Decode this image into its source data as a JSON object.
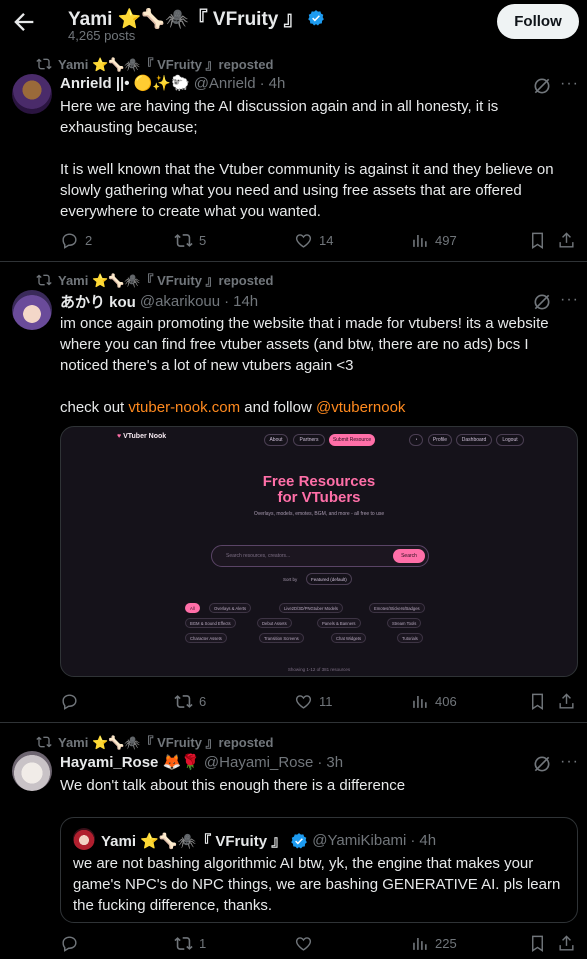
{
  "header": {
    "back_icon": "arrow-left-icon",
    "title": "Yami ⭐🦴🕷️『 VFruity 』",
    "posts_count": "4,265 posts",
    "follow_label": "Follow"
  },
  "colors": {
    "accent_link": "#ff8a1f",
    "verified": "#1d9bf0",
    "muted": "#71767b",
    "text": "#e7e9ea",
    "border": "#2f3336"
  },
  "posts": [
    {
      "repost_label": "Yami ⭐🦴🕷️『 VFruity 』reposted",
      "author": "Anrield ||• 🟡✨🐑",
      "handle": "@Anrield",
      "time": "4h",
      "text_p1": "Here we are having the AI discussion again and in all honesty, it is exhausting because;",
      "text_p2": "It is well known that the Vtuber community is against it and they believe on slowly gathering what you need and using free assets that are offered everywhere to create what you wanted.",
      "replies": "2",
      "reposts": "5",
      "likes": "14",
      "views": "497"
    },
    {
      "repost_label": "Yami ⭐🦴🕷️『 VFruity 』reposted",
      "author": "あかり kou",
      "handle": "@akarikouu",
      "time": "14h",
      "text_p1": "im once again promoting the website that i made for vtubers! its a website where you can find free vtuber assets (and btw, there are no ads) bcs I noticed there's a lot of new vtubers again <3",
      "text_p2_prefix": "check out ",
      "link1": "vtuber-nook.com",
      "text_p2_mid": " and follow ",
      "link2": "@vtubernook",
      "replies": "",
      "reposts": "6",
      "likes": "11",
      "views": "406",
      "media": {
        "brand": "VTuber Nook",
        "nav": [
          "About",
          "Partners",
          "Submit Resource",
          "Profile",
          "Dashboard",
          "Logout"
        ],
        "heading1": "Free Resources",
        "heading2": "for VTubers",
        "tagline": "Overlays, models, emotes, BGM, and more - all free to use",
        "search_placeholder": "Search resources, creators...",
        "search_button": "Search",
        "sort_label": "Sort by",
        "sort_value": "Featured (default)",
        "chips": [
          "All",
          "Overlays & Alerts",
          "Live2D/3D/PNGtuber Models",
          "Emotes/Stickers/Badges",
          "BGM & Sound Effects",
          "Debut Assets",
          "Panels & Banners",
          "Stream Tools",
          "Character Assets",
          "Transition Screens",
          "Chat Widgets",
          "Tutorials"
        ],
        "footer": "Showing 1-12 of 381 resources"
      }
    },
    {
      "repost_label": "Yami ⭐🦴🕷️『 VFruity 』reposted",
      "author": "Hayami_Rose 🦊🌹",
      "handle": "@Hayami_Rose",
      "time": "3h",
      "text_p1": "We don't talk about this enough there is a difference",
      "quote": {
        "author": "Yami ⭐🦴🕷️『 VFruity 』",
        "handle": "@YamiKibami",
        "time": "4h",
        "text": "we are not bashing algorithmic AI btw, yk, the engine that makes your game's NPC's do NPC things, we are bashing GENERATIVE AI. pls learn the fucking difference, thanks."
      },
      "replies": "",
      "reposts": "1",
      "likes": "",
      "views": "225"
    }
  ]
}
